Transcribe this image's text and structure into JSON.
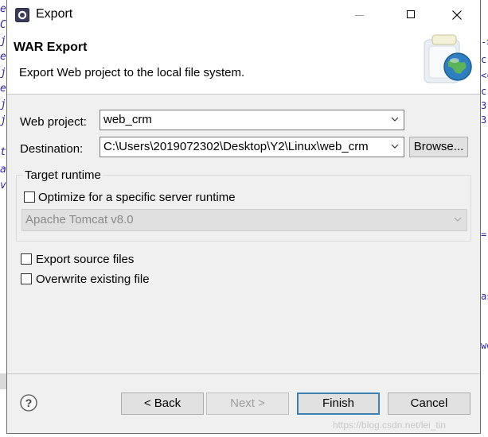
{
  "window": {
    "title": "Export"
  },
  "header": {
    "title": "WAR Export",
    "description": "Export Web project to the local file system."
  },
  "form": {
    "web_project_label": "Web project:",
    "web_project_value": "web_crm",
    "destination_label": "Destination:",
    "destination_value": "C:\\Users\\2019072302\\Desktop\\Y2\\Linux\\web_crm",
    "browse_label": "Browse..."
  },
  "target_runtime": {
    "group_label": "Target runtime",
    "optimize_label": "Optimize for a specific server runtime",
    "optimize_checked": false,
    "runtime_value": "Apache Tomcat v8.0",
    "runtime_enabled": false
  },
  "options": {
    "export_source_label": "Export source files",
    "export_source_checked": false,
    "overwrite_label": "Overwrite existing file",
    "overwrite_checked": false
  },
  "buttons": {
    "back": "< Back",
    "next": "Next >",
    "finish": "Finish",
    "cancel": "Cancel"
  },
  "watermark": "https://blog.csdn.net/lei_tin",
  "background_editor": {
    "left_glyphs": [
      "e",
      "C",
      "j",
      "e",
      "j",
      "e",
      "j",
      "j",
      "t",
      "a",
      "v"
    ],
    "right_glyphs": [
      "->",
      "c:",
      "<c",
      "c:",
      "3",
      "3",
      "=",
      "as",
      "wo"
    ]
  },
  "colors": {
    "dialog_bg": "#f0f0f0",
    "header_bg": "#ffffff",
    "default_button_border": "#3c7fb1",
    "disabled_text": "#9d9d9d"
  }
}
